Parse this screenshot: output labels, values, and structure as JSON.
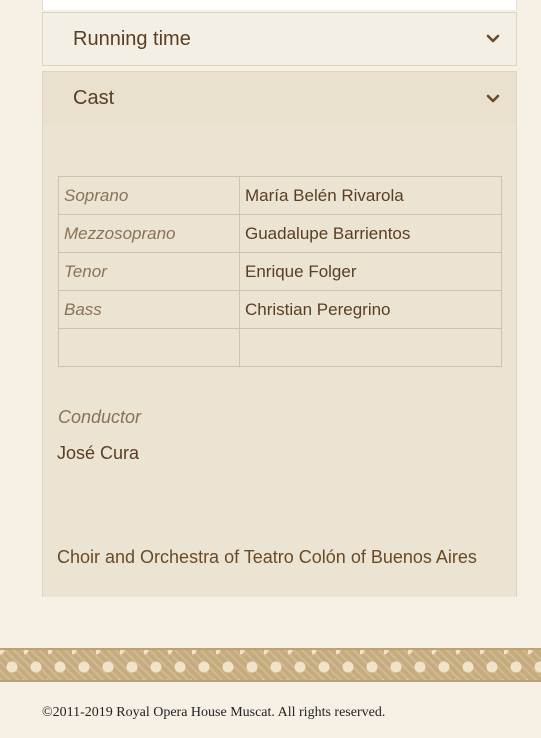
{
  "accordion": {
    "running_time_label": "Running time",
    "cast_label": "Cast"
  },
  "cast": {
    "rows": [
      {
        "role": "Soprano",
        "name": "María Belén Rivarola"
      },
      {
        "role": "Mezzosoprano",
        "name": "Guadalupe Barrientos"
      },
      {
        "role": "Tenor",
        "name": "Enrique Folger"
      },
      {
        "role": "Bass",
        "name": "Christian Peregrino"
      },
      {
        "role": "",
        "name": ""
      }
    ],
    "conductor_label": "Conductor",
    "conductor_name": "José Cura",
    "ensemble": "Choir and Orchestra of Teatro Colón of Buenos Aires"
  },
  "footer": {
    "copyright": "©2011-2019 Royal Opera House Muscat. All rights reserved."
  },
  "icons": {
    "chevron": "chevron-down-icon"
  },
  "colors": {
    "text_brown": "#5a3e22",
    "role_text": "#8a7256",
    "panel_bg": "#ece4d3",
    "page_bg": "#f7f0e4"
  }
}
